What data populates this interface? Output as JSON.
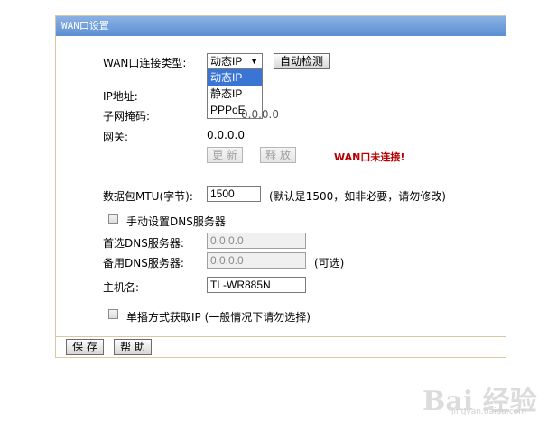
{
  "panel": {
    "title": "WAN口设置"
  },
  "form": {
    "conn_type_label": "WAN口连接类型:",
    "conn_type_value": "动态IP",
    "detect_button": "自动检测",
    "options": [
      "动态IP",
      "静态IP",
      "PPPoE"
    ],
    "ip_label": "IP地址:",
    "mask_label": "子网掩码:",
    "mask_value_partial": "0.0.0.0",
    "gateway_label": "网关:",
    "gateway_value": "0.0.0.0",
    "renew_button": "更 新",
    "release_button": "释 放",
    "status_warning": "WAN口未连接!",
    "mtu_label": "数据包MTU(字节):",
    "mtu_value": "1500",
    "mtu_hint": "(默认是1500，如非必要，请勿修改)",
    "manual_dns_label": "手动设置DNS服务器",
    "dns1_label": "首选DNS服务器:",
    "dns1_value": "0.0.0.0",
    "dns2_label": "备用DNS服务器:",
    "dns2_value": "0.0.0.0",
    "dns2_hint": "(可选)",
    "hostname_label": "主机名:",
    "hostname_value": "TL-WR885N",
    "unicast_label": "单播方式获取IP  (一般情况下请勿选择)"
  },
  "footer": {
    "save_button": "保 存",
    "help_button": "帮 助"
  },
  "watermark": {
    "brand": "Bai 经验",
    "url": "jingyan.baidu.com"
  }
}
